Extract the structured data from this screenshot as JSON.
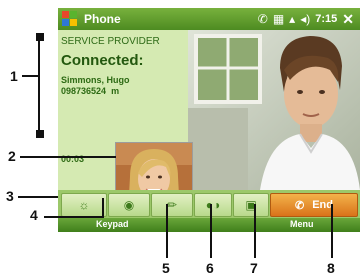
{
  "titlebar": {
    "title": "Phone",
    "clock": "7:15"
  },
  "call": {
    "provider": "SERVICE PROVIDER",
    "status": "Connected:",
    "name": "Simmons, Hugo",
    "number": "098736524",
    "number_type": "m",
    "timer": "00:03"
  },
  "toolbar": {
    "end_label": "End"
  },
  "softkeys": {
    "left": "Keypad",
    "right": "Menu"
  },
  "callouts": [
    "1",
    "2",
    "3",
    "4",
    "5",
    "6",
    "7",
    "8"
  ],
  "colors": {
    "accent": "#4d8b21",
    "end_button": "#e08a28",
    "panel": "#d5eab2"
  }
}
